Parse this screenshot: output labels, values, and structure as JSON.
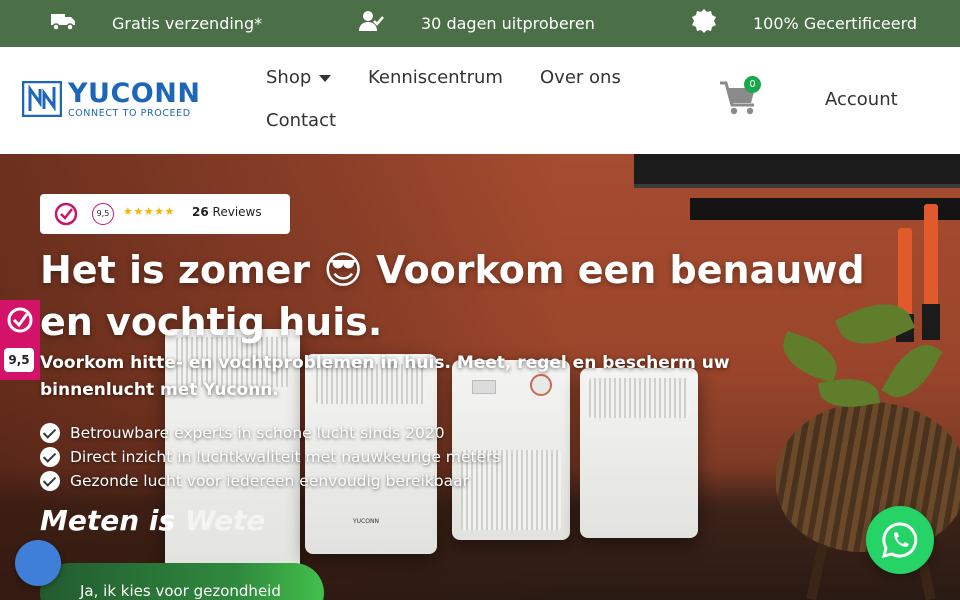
{
  "topbar": {
    "items": [
      {
        "icon": "truck-icon",
        "label": "Gratis verzending*"
      },
      {
        "icon": "user-check-icon",
        "label": "30 dagen uitproberen"
      },
      {
        "icon": "certificate-badge-icon",
        "label": "100% Gecertificeerd"
      }
    ],
    "background": "#4b7047"
  },
  "header": {
    "logo": {
      "name": "YUCONN",
      "tagline": "CONNECT TO PROCEED",
      "color": "#1e66b8"
    },
    "nav": [
      {
        "label": "Shop",
        "has_dropdown": true
      },
      {
        "label": "Kenniscentrum"
      },
      {
        "label": "Over ons"
      },
      {
        "label": "Contact"
      }
    ],
    "cart_count": "0",
    "account_label": "Account"
  },
  "hero": {
    "rating": {
      "score": "9,5",
      "stars": "★★★★★",
      "count": "26",
      "count_label": "Reviews"
    },
    "title": "Het is zomer 😎 Voorkom een benauwd en vochtig huis.",
    "subtitle": "Voorkom hitte- en vochtproblemen in huis. Meet, regel en bescherm uw binnenlucht met Yuconn.",
    "checks": [
      "Betrouwbare experts in schone lucht sinds 2020",
      "Direct inzicht in luchtkwaliteit met nauwkeurige meters",
      "Gezonde lucht voor iedereen eenvoudig bereikbaar"
    ],
    "tagline_main": "Meten is ",
    "tagline_faded": "Wete",
    "cta_label": "Ja, ik kies voor gezondheid",
    "product_label": "YUCONN"
  },
  "side_widget": {
    "score": "9,5",
    "color": "#d3136a"
  },
  "accent_green": "#25d366"
}
